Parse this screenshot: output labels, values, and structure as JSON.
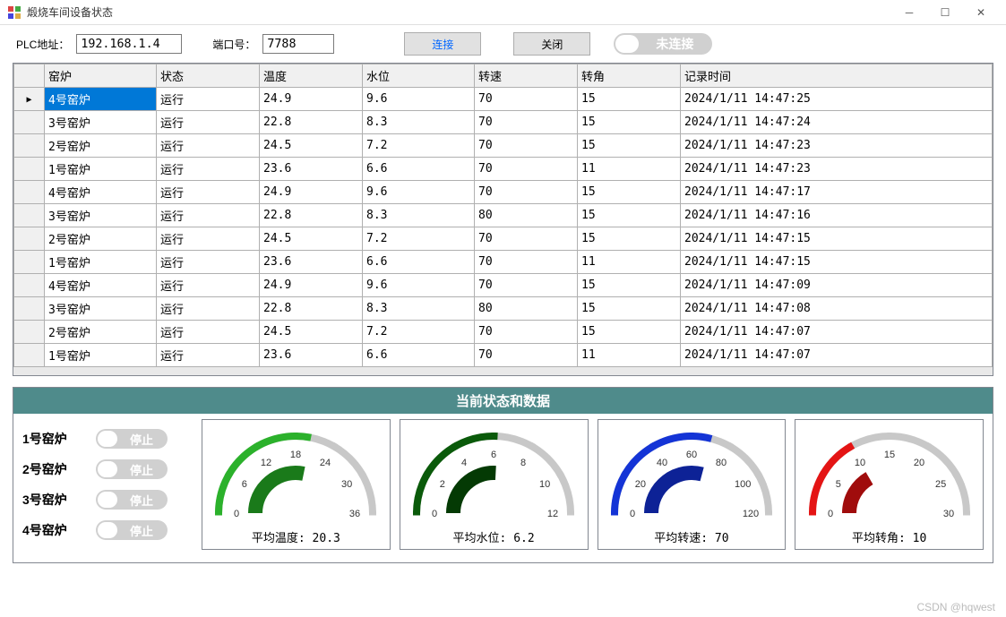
{
  "window": {
    "title": "煅烧车间设备状态"
  },
  "top": {
    "plc_label": "PLC地址：",
    "plc_value": "192.168.1.4",
    "port_label": "端口号：",
    "port_value": "7788",
    "connect": "连接",
    "close": "关闭",
    "conn_status": "未连接"
  },
  "grid": {
    "headers": [
      "窑炉",
      "状态",
      "温度",
      "水位",
      "转速",
      "转角",
      "记录时间"
    ],
    "rows": [
      [
        "4号窑炉",
        "运行",
        "24.9",
        "9.6",
        "70",
        "15",
        "2024/1/11 14:47:25"
      ],
      [
        "3号窑炉",
        "运行",
        "22.8",
        "8.3",
        "70",
        "15",
        "2024/1/11 14:47:24"
      ],
      [
        "2号窑炉",
        "运行",
        "24.5",
        "7.2",
        "70",
        "15",
        "2024/1/11 14:47:23"
      ],
      [
        "1号窑炉",
        "运行",
        "23.6",
        "6.6",
        "70",
        "11",
        "2024/1/11 14:47:23"
      ],
      [
        "4号窑炉",
        "运行",
        "24.9",
        "9.6",
        "70",
        "15",
        "2024/1/11 14:47:17"
      ],
      [
        "3号窑炉",
        "运行",
        "22.8",
        "8.3",
        "80",
        "15",
        "2024/1/11 14:47:16"
      ],
      [
        "2号窑炉",
        "运行",
        "24.5",
        "7.2",
        "70",
        "15",
        "2024/1/11 14:47:15"
      ],
      [
        "1号窑炉",
        "运行",
        "23.6",
        "6.6",
        "70",
        "11",
        "2024/1/11 14:47:15"
      ],
      [
        "4号窑炉",
        "运行",
        "24.9",
        "9.6",
        "70",
        "15",
        "2024/1/11 14:47:09"
      ],
      [
        "3号窑炉",
        "运行",
        "22.8",
        "8.3",
        "80",
        "15",
        "2024/1/11 14:47:08"
      ],
      [
        "2号窑炉",
        "运行",
        "24.5",
        "7.2",
        "70",
        "15",
        "2024/1/11 14:47:07"
      ],
      [
        "1号窑炉",
        "运行",
        "23.6",
        "6.6",
        "70",
        "11",
        "2024/1/11 14:47:07"
      ]
    ]
  },
  "status": {
    "header": "当前状态和数据",
    "kilns": [
      {
        "name": "1号窑炉",
        "label": "停止"
      },
      {
        "name": "2号窑炉",
        "label": "停止"
      },
      {
        "name": "3号窑炉",
        "label": "停止"
      },
      {
        "name": "4号窑炉",
        "label": "停止"
      }
    ],
    "gauges": [
      {
        "caption": "平均温度: 20.3",
        "color": "#2bb12b",
        "darkcolor": "#1a7a1a",
        "max": 36,
        "ticks": [
          "0",
          "6",
          "12",
          "18",
          "24",
          "30",
          "36"
        ],
        "value": 20.3
      },
      {
        "caption": "平均水位: 6.2",
        "color": "#0a5a0a",
        "darkcolor": "#043a04",
        "max": 12,
        "ticks": [
          "0",
          "2",
          "4",
          "6",
          "8",
          "10",
          "12"
        ],
        "value": 6.2
      },
      {
        "caption": "平均转速: 70",
        "color": "#1434d6",
        "darkcolor": "#0d2296",
        "max": 120,
        "ticks": [
          "0",
          "20",
          "40",
          "60",
          "80",
          "100",
          "120"
        ],
        "value": 70
      },
      {
        "caption": "平均转角: 10",
        "color": "#e41414",
        "darkcolor": "#a00c0c",
        "max": 30,
        "ticks": [
          "0",
          "5",
          "10",
          "15",
          "20",
          "25",
          "30"
        ],
        "value": 10
      }
    ]
  },
  "footer": "CSDN @hqwest"
}
